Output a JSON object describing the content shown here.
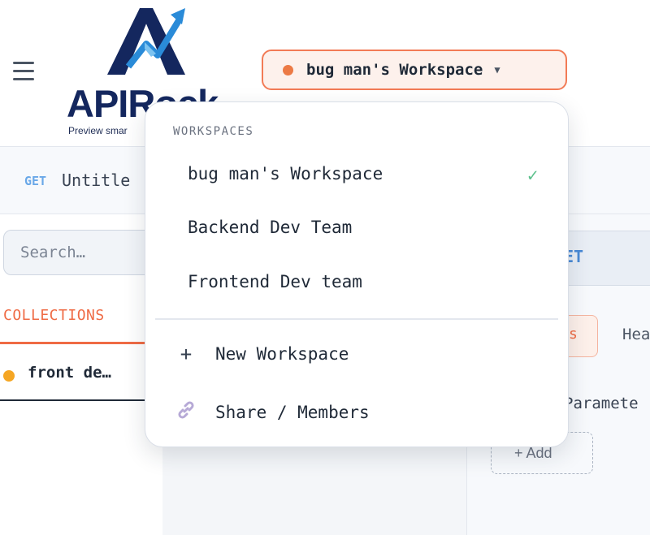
{
  "header": {
    "menu_icon": "hamburger-icon",
    "logo_text": "APIRock",
    "logo_tagline": "Preview smar",
    "workspace_button": {
      "label": "bug man's Workspace",
      "caret": "▼",
      "dot_color": "#ec7a45"
    }
  },
  "tab": {
    "method": "GET",
    "title": "Untitle"
  },
  "sidebar": {
    "search_placeholder": "Search…",
    "collections_label": "COLLECTIONS",
    "collection_items": [
      {
        "name": "front de…",
        "dot_color": "#f5a623"
      }
    ]
  },
  "request": {
    "method": "ET",
    "subtab_active": "s",
    "subtab_other": "Hea",
    "params_label": "Paramete",
    "add_label": "+ Add"
  },
  "workspace_menu": {
    "section_title": "WORKSPACES",
    "workspaces": [
      {
        "name": "bug man's Workspace",
        "selected": true
      },
      {
        "name": "Backend Dev Team",
        "selected": false
      },
      {
        "name": "Frontend Dev team",
        "selected": false
      }
    ],
    "check_mark": "✓",
    "actions": [
      {
        "icon": "plus-icon",
        "glyph": "+",
        "label": "New Workspace"
      },
      {
        "icon": "link-icon",
        "glyph": "🔗",
        "label": "Share / Members"
      }
    ]
  },
  "colors": {
    "accent": "#ef6b45",
    "brand_navy": "#14275e",
    "brand_blue": "#2a8bd8",
    "success": "#5cc08c",
    "method_get": "#6aa8e8"
  }
}
